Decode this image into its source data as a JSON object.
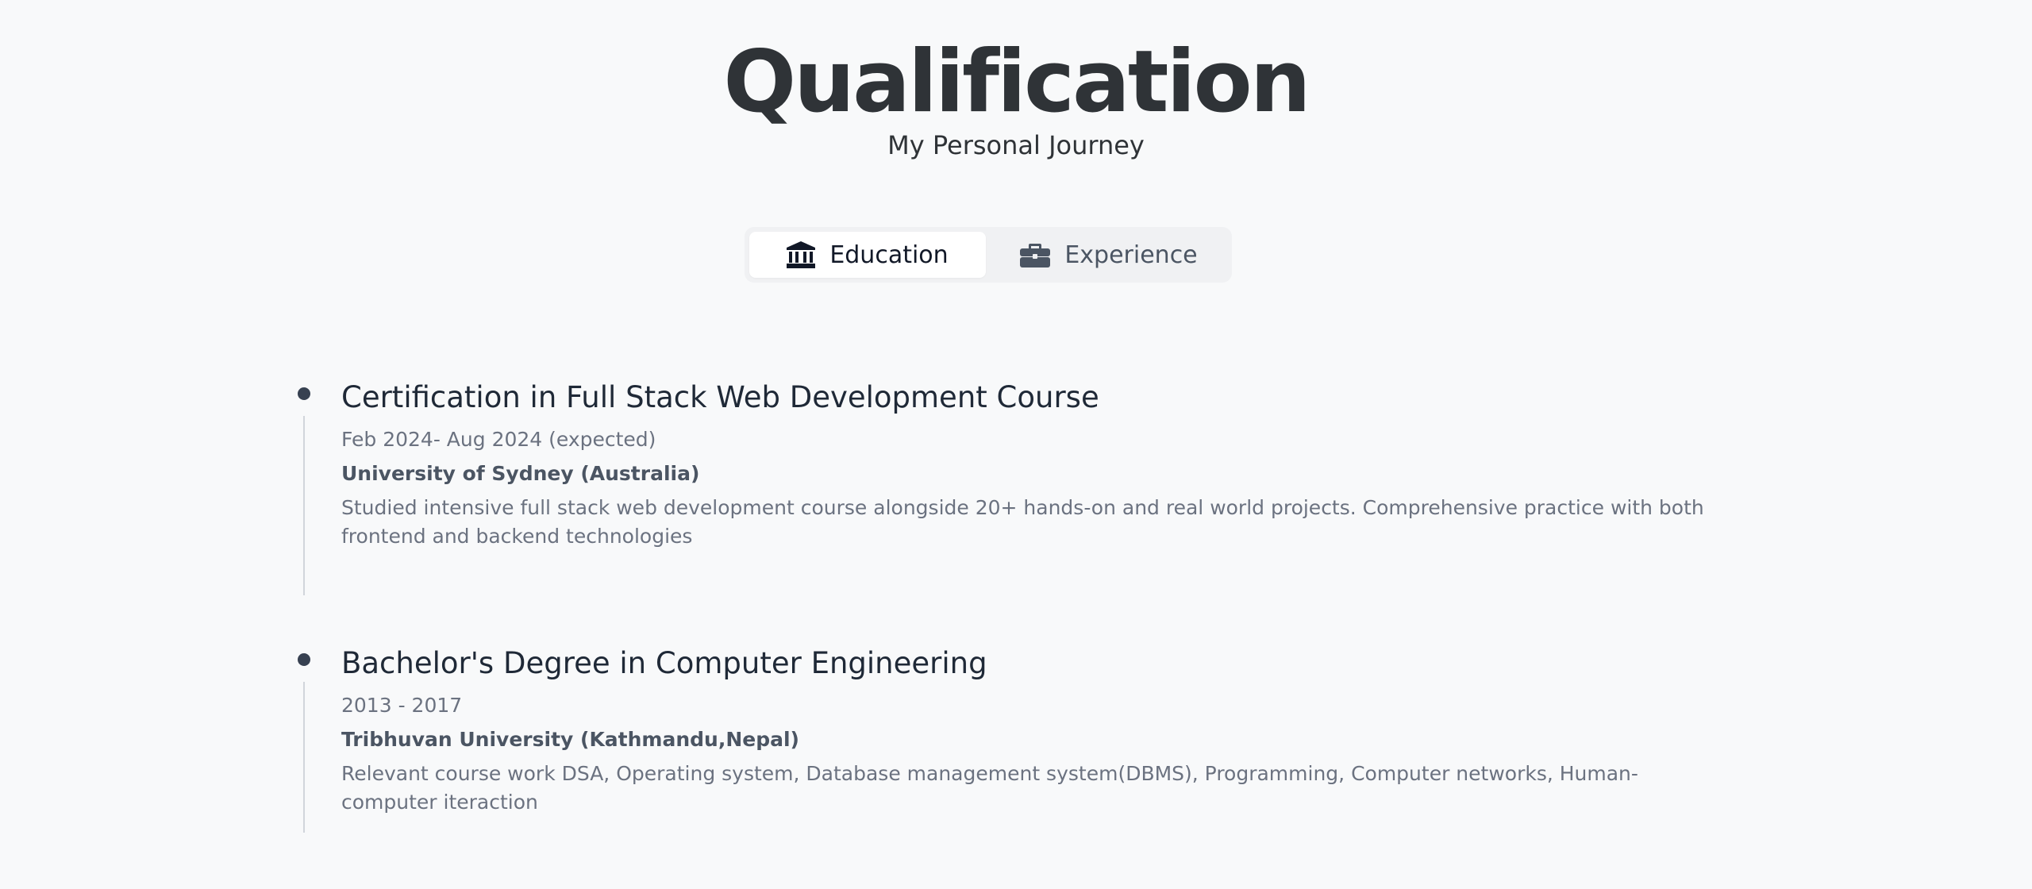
{
  "header": {
    "title": "Qualification",
    "subtitle": "My Personal Journey"
  },
  "tabs": [
    {
      "label": "Education",
      "icon": "university-icon",
      "active": true
    },
    {
      "label": "Experience",
      "icon": "briefcase-icon",
      "active": false
    }
  ],
  "education": [
    {
      "title": "Certification in Full Stack Web Development Course",
      "date": "Feb 2024- Aug 2024 (expected)",
      "org": "University of Sydney (Australia)",
      "description": "Studied intensive full stack web development course alongside 20+ hands-on and real world projects. Comprehensive practice with both frontend and backend technologies"
    },
    {
      "title": "Bachelor's Degree in Computer Engineering",
      "date": "2013 - 2017",
      "org": "Tribhuvan University (Kathmandu,Nepal)",
      "description": "Relevant course work DSA, Operating system, Database management system(DBMS), Programming, Computer networks, Human-computer iteraction"
    }
  ],
  "colors": {
    "background": "#f8f9fa",
    "text_dark": "#2f3337",
    "text_muted": "#6b7280",
    "timeline_line": "#d1d5db"
  }
}
